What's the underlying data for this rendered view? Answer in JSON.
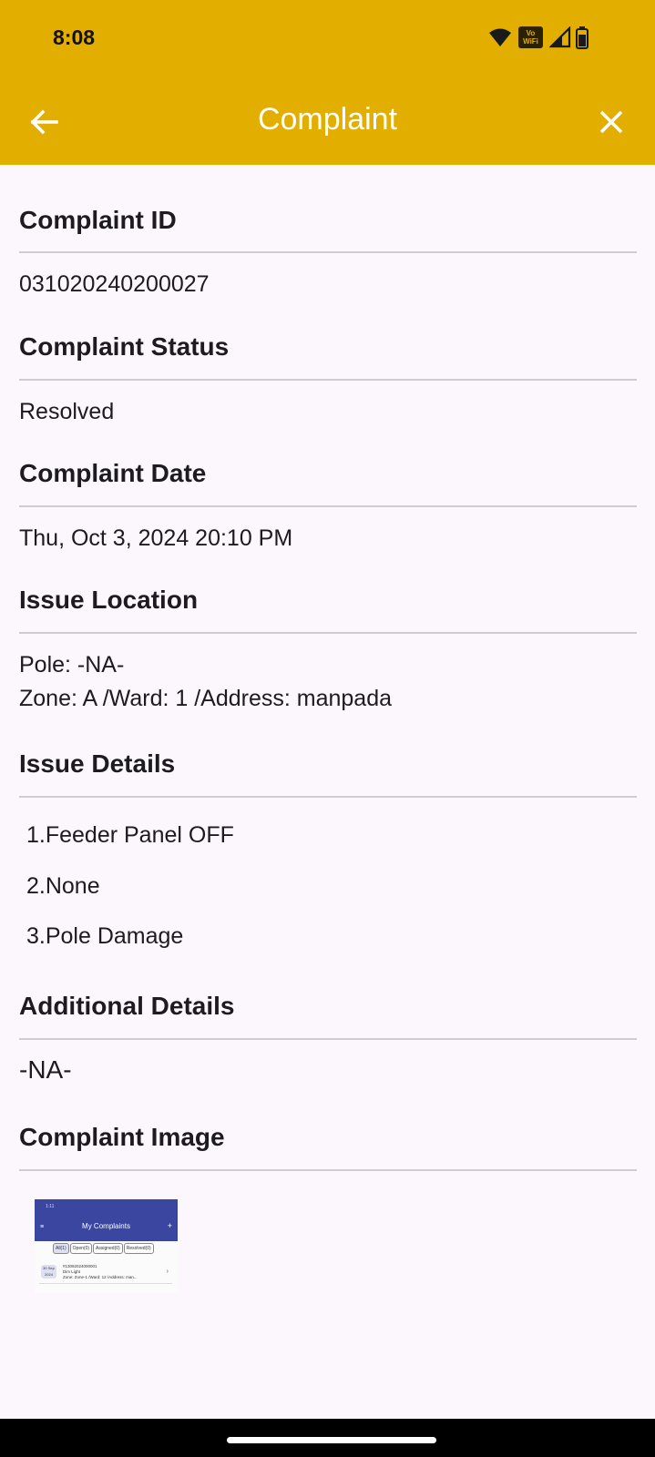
{
  "status_bar": {
    "time": "8:08",
    "vowifi_top": "Vo",
    "vowifi_bottom": "WiFi",
    "icons": [
      "wifi-icon",
      "vowifi-icon",
      "signal-icon",
      "battery-icon"
    ]
  },
  "app_bar": {
    "title": "Complaint",
    "back_icon": "arrow-back-icon",
    "close_icon": "close-icon",
    "background": "#e2ae00",
    "title_color": "#ffffff"
  },
  "sections": {
    "complaint_id": {
      "heading": "Complaint ID",
      "value": "031020240200027"
    },
    "complaint_status": {
      "heading": "Complaint Status",
      "value": "Resolved"
    },
    "complaint_date": {
      "heading": "Complaint Date",
      "value": "Thu, Oct 3, 2024 20:10 PM"
    },
    "issue_location": {
      "heading": "Issue Location",
      "pole": "Pole: -NA-",
      "address": "Zone: A /Ward: 1 /Address: manpada"
    },
    "issue_details": {
      "heading": "Issue Details",
      "items": [
        "1.Feeder Panel OFF",
        "2.None",
        "3.Pole Damage"
      ]
    },
    "additional_details": {
      "heading": "Additional Details",
      "value": "-NA-"
    },
    "complaint_image": {
      "heading": "Complaint Image",
      "thumbnail": {
        "title": "My Complaints",
        "status_time": "1:11",
        "tabs": [
          "All(1)",
          "Open(0)",
          "Assigned(0)",
          "Resolved(0)"
        ],
        "row_date": "30 Sep 2024",
        "row_id": "#13092024000001",
        "row_type": "Dim Light",
        "row_address": "Zone: Zone-1 /Ward: 12 /Address: man..."
      }
    }
  }
}
